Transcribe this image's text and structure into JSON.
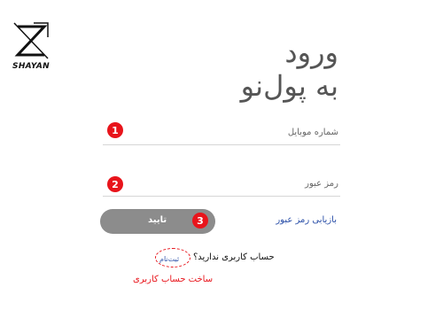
{
  "brand": {
    "logo_text": "SHAYAN"
  },
  "heading": {
    "line1": "ورود",
    "line2": "به پول‌نو"
  },
  "form": {
    "mobile_placeholder": "شماره موبایل",
    "password_placeholder": "رمز عبور",
    "submit_label": "تایید",
    "forgot_label": "بازیابی رمز عبور"
  },
  "signup": {
    "question": "حساب کاربری ندارید؟",
    "link_label": "ثبت‌نام"
  },
  "annotations": {
    "badge_1": "1",
    "badge_2": "2",
    "badge_3": "3",
    "note": "ساخت حساب کاربری"
  },
  "colors": {
    "accent_red": "#e8141b",
    "link_blue": "#2a4fa8",
    "button_gray": "#8c8c8c"
  }
}
